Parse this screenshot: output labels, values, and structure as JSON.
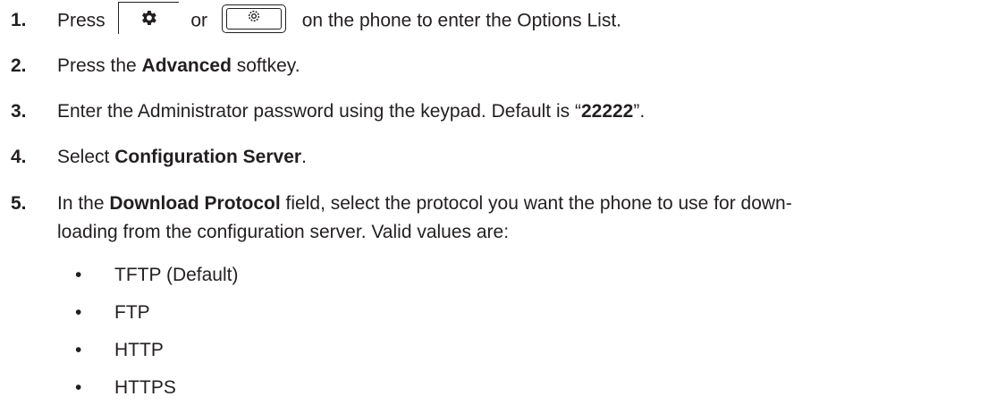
{
  "steps": [
    {
      "num": "1.",
      "pre": "Press",
      "or": "or",
      "post": "on the phone to enter the Options List."
    },
    {
      "num": "2.",
      "a": "Press the ",
      "b": "Advanced",
      "c": " softkey."
    },
    {
      "num": "3.",
      "a": "Enter the Administrator password using the keypad. Default is “",
      "b": "22222",
      "c": "”."
    },
    {
      "num": "4.",
      "a": "Select ",
      "b": "Configuration Server",
      "c": "."
    },
    {
      "num": "5.",
      "a": "In the ",
      "b": "Download Protocol",
      "c": " field, select the protocol you want the phone to use for down-",
      "line2": "loading from the configuration server. Valid values are:"
    }
  ],
  "bullets": [
    "TFTP (Default)",
    "FTP",
    "HTTP",
    "HTTPS"
  ],
  "bullet_char": "•",
  "icons": {
    "key1": "gear-icon",
    "key2": "options-key-icon"
  }
}
